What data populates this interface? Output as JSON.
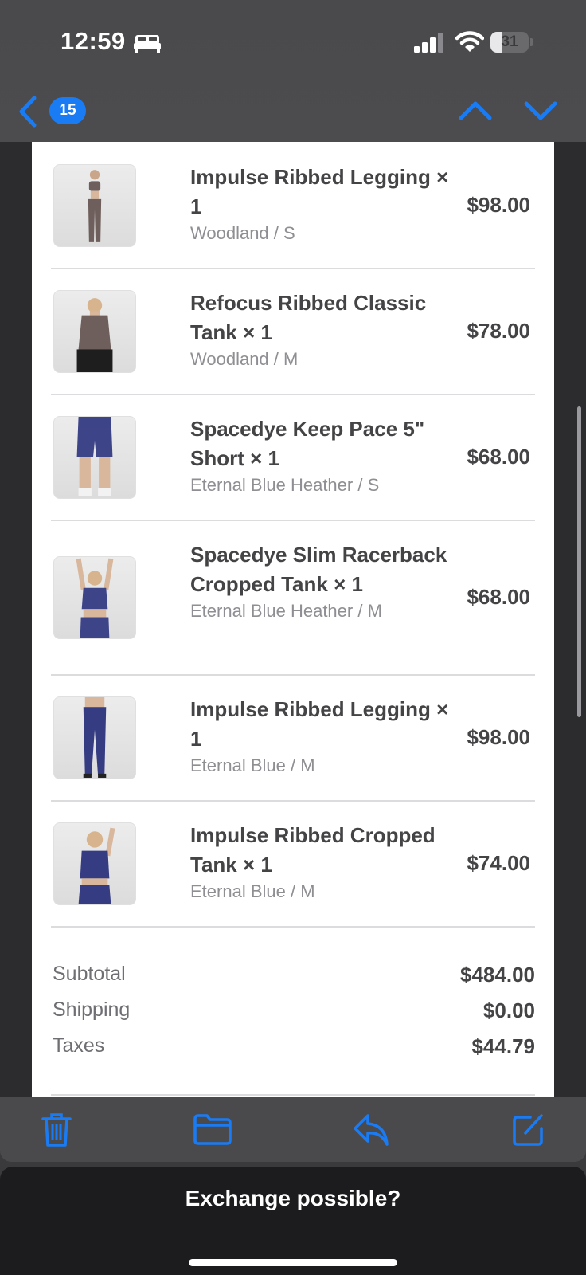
{
  "status_bar": {
    "time": "12:59",
    "focus_icon": "bed-icon",
    "signal_icon": "cellular-signal-icon",
    "wifi_icon": "wifi-icon",
    "battery_percent": "31",
    "battery_level": 0.31
  },
  "nav": {
    "back_icon": "chevron-left-icon",
    "unread_count": "15",
    "prev_icon": "chevron-up-icon",
    "next_icon": "chevron-down-icon",
    "accent_color": "#1a7cf5"
  },
  "order": {
    "items": [
      {
        "name": "Impulse Ribbed Legging × 1",
        "variant": "Woodland / S",
        "price": "$98.00",
        "product_color": "#6f5f5c",
        "image": "legging-set-woodland"
      },
      {
        "name": "Refocus Ribbed Classic Tank × 1",
        "variant": "Woodland / M",
        "price": "$78.00",
        "product_color": "#6f5f5c",
        "image": "tank-woodland"
      },
      {
        "name": "Spacedye Keep Pace 5\" Short × 1",
        "variant": "Eternal Blue Heather / S",
        "price": "$68.00",
        "product_color": "#3d4488",
        "image": "short-blue"
      },
      {
        "name": "Spacedye Slim Racerback Cropped Tank × 1",
        "variant": "Eternal Blue Heather / M",
        "price": "$68.00",
        "product_color": "#3d4488",
        "image": "cropped-tank-blue"
      },
      {
        "name": "Impulse Ribbed Legging × 1",
        "variant": "Eternal Blue / M",
        "price": "$98.00",
        "product_color": "#353c82",
        "image": "legging-blue"
      },
      {
        "name": "Impulse Ribbed Cropped Tank × 1",
        "variant": "Eternal Blue / M",
        "price": "$74.00",
        "product_color": "#353c82",
        "image": "cropped-tank-eternal-blue"
      }
    ],
    "summary": [
      {
        "label": "Subtotal",
        "value": "$484.00"
      },
      {
        "label": "Shipping",
        "value": "$0.00"
      },
      {
        "label": "Taxes",
        "value": "$44.79"
      }
    ]
  },
  "toolbar": {
    "trash_icon": "trash-icon",
    "folder_icon": "folder-icon",
    "reply_icon": "reply-icon",
    "compose_icon": "compose-icon"
  },
  "sheet": {
    "title": "Exchange possible?"
  }
}
